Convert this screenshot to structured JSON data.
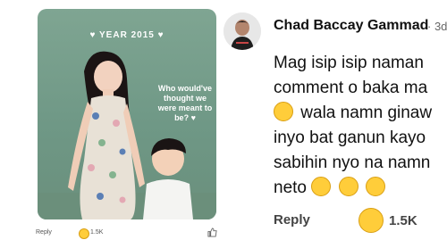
{
  "left": {
    "photo": {
      "year_text": "♥ YEAR 2015 ♥",
      "quote": "Who would've thought we were meant to be? ♥"
    },
    "reply_label": "Reply",
    "reaction_count": "1.5K"
  },
  "right": {
    "author": "Chad Baccay Gammad",
    "meta": "· 3d",
    "comment_lines": [
      "Mag isip isip naman",
      "comment o baka ma",
      "wala namn ginaw",
      "inyo bat ganun kayo",
      "sabihin nyo na namn",
      "neto"
    ],
    "reply_label": "Reply",
    "reaction_count": "1.5K"
  },
  "colors": {
    "photo_bg": "#7fa592",
    "reaction_yellow": "#ffcd3a"
  }
}
